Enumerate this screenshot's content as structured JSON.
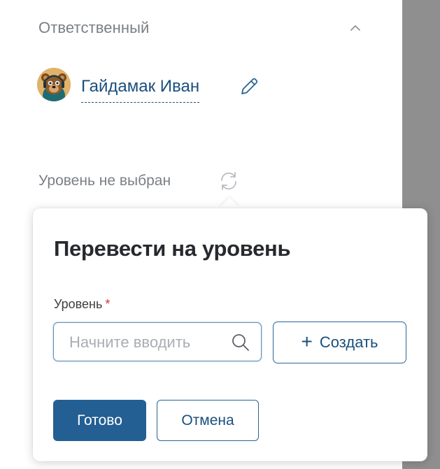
{
  "responsible": {
    "title": "Ответственный",
    "collapse_icon": "chevron-up-icon",
    "user_name": "Гайдамак Иван",
    "avatar_icon": "bear-avatar",
    "edit_icon": "pencil-icon"
  },
  "level": {
    "status_text": "Уровень не выбран",
    "refresh_icon": "refresh-icon"
  },
  "popover": {
    "title": "Перевести на уровень",
    "field_label": "Уровень",
    "required_mark": "*",
    "search_placeholder": "Начните вводить",
    "search_value": "",
    "create_label": "Создать",
    "create_icon": "plus-icon",
    "done_label": "Готово",
    "cancel_label": "Отмена"
  },
  "colors": {
    "accent": "#235f93",
    "link": "#1b4f7c",
    "muted_text": "#7a7f86",
    "required": "#d23535",
    "overlay": "#8f8f8f"
  }
}
